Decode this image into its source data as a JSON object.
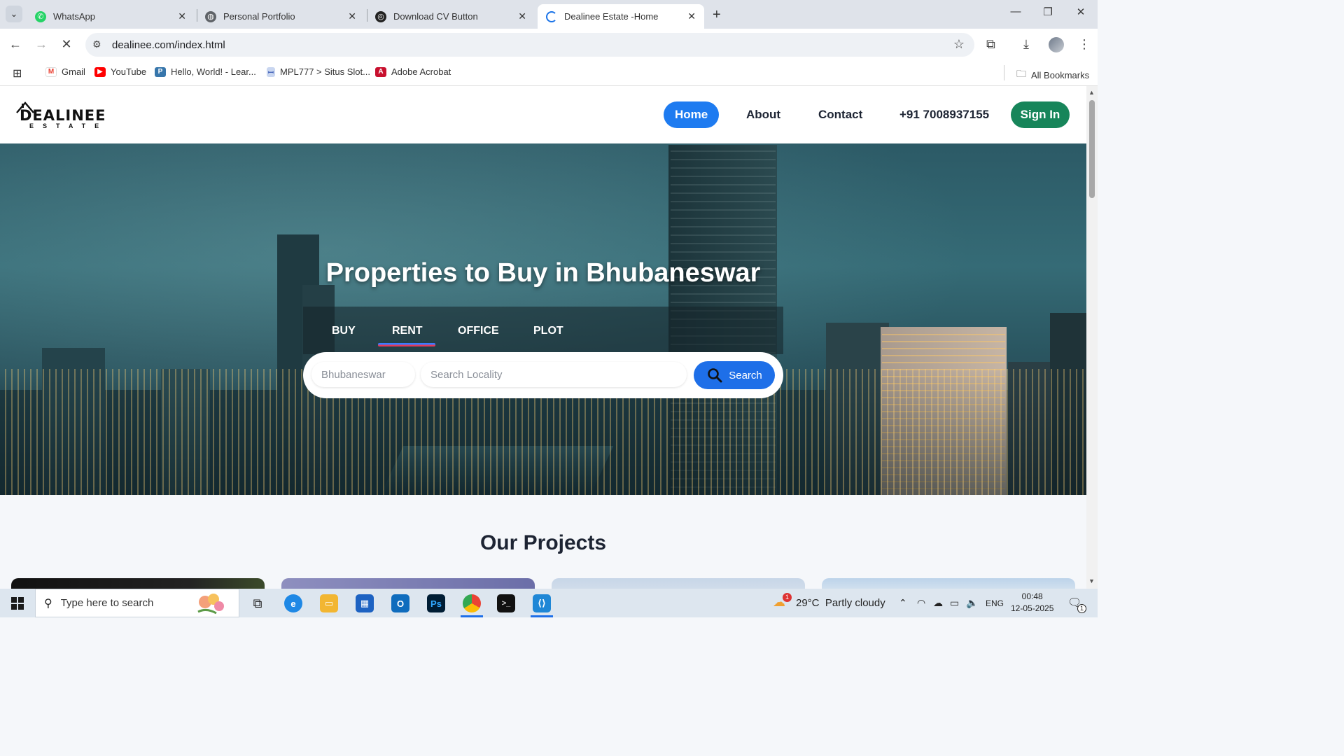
{
  "browser": {
    "tabs": [
      {
        "title": "WhatsApp",
        "icon": "whatsapp-icon"
      },
      {
        "title": "Personal Portfolio",
        "icon": "globe-icon"
      },
      {
        "title": "Download CV Button",
        "icon": "codepen-icon"
      },
      {
        "title": "Dealinee Estate -Home",
        "icon": "loading-icon",
        "active": true
      }
    ],
    "url": "dealinee.com/index.html",
    "bookmarks": [
      {
        "label": "Gmail",
        "icon": "gmail-icon"
      },
      {
        "label": "YouTube",
        "icon": "youtube-icon"
      },
      {
        "label": "Hello, World! - Lear...",
        "icon": "python-icon"
      },
      {
        "label": "MPL777 > Situs Slot...",
        "icon": "site-icon"
      },
      {
        "label": "Adobe Acrobat",
        "icon": "acrobat-icon"
      }
    ],
    "all_bookmarks": "All Bookmarks"
  },
  "site": {
    "logo_text": "DEALINEE",
    "logo_sub": "ESTATE",
    "nav": {
      "home": "Home",
      "about": "About",
      "contact": "Contact",
      "phone": "+91 7008937155",
      "signin": "Sign In"
    },
    "hero": {
      "title": "Properties to Buy in Bhubaneswar",
      "tabs": [
        "BUY",
        "RENT",
        "OFFICE",
        "PLOT"
      ],
      "active_tab": "RENT",
      "city_placeholder": "Bhubaneswar",
      "locality_placeholder": "Search Locality",
      "search_label": "Search"
    },
    "projects_title": "Our Projects"
  },
  "taskbar": {
    "search_placeholder": "Type here to search",
    "weather": "29°C  Partly cloudy",
    "weather_badge": "1",
    "lang": "ENG",
    "time": "00:48",
    "date": "12-05-2025",
    "notification_count": "1"
  },
  "colors": {
    "primary": "#1e7bf0",
    "signin": "#17855a",
    "tab_underline_top": "#3a7bff",
    "tab_underline_bottom": "#e23b5b"
  }
}
